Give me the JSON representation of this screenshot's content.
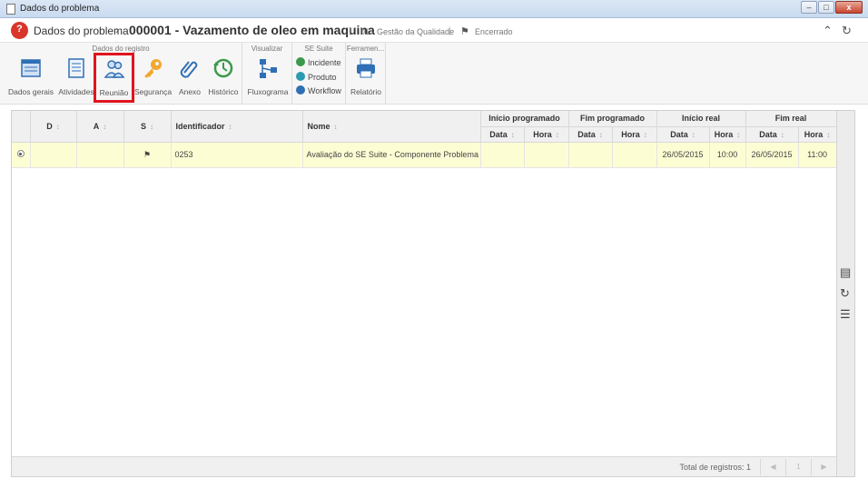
{
  "window": {
    "title": "Dados do problema",
    "minimize": "–",
    "maximize": "□",
    "close": "x"
  },
  "header": {
    "breadcrumb": "Dados do problema",
    "record_title": "000001 - Vazamento de oleo em maquina",
    "process": "01 - Gestão da Qualidade",
    "status": "Encerrado",
    "separator": "|",
    "chevron": "›",
    "status_icon": "⚑",
    "collapse_icon": "⌃",
    "refresh_icon": "↻"
  },
  "toolbar": {
    "groups": [
      {
        "label": "Dados do registro"
      },
      {
        "label": "Visualizar"
      },
      {
        "label": "SE Suite"
      },
      {
        "label": "Ferramen..."
      }
    ],
    "buttons": {
      "dados_gerais": "Dados gerais",
      "atividades": "Atividades",
      "reuniao": "Reunião",
      "seguranca": "Segurança",
      "anexo": "Anexo",
      "historico": "Histórico",
      "fluxograma": "Fluxograma",
      "incidente": "Incidente",
      "produto": "Produto",
      "workflow": "Workflow",
      "relatorio": "Relatório"
    },
    "selected": "reuniao"
  },
  "grid": {
    "columns": {
      "d": "D",
      "a": "A",
      "s": "S",
      "identificador": "Identificador",
      "nome": "Nome"
    },
    "group_headers": {
      "inicio_programado": "Início programado",
      "fim_programado": "Fim programado",
      "inicio_real": "Início real",
      "fim_real": "Fim real"
    },
    "sub": {
      "data": "Data",
      "hora": "Hora"
    },
    "sort_icon": "↕",
    "rows": [
      {
        "identificador": "0253",
        "nome": "Avaliação do SE Suite - Componente Problema",
        "inicio_prog_data": "",
        "inicio_prog_hora": "",
        "fim_prog_data": "",
        "fim_prog_hora": "",
        "inicio_real_data": "26/05/2015",
        "inicio_real_hora": "10:00",
        "fim_real_data": "26/05/2015",
        "fim_real_hora": "11:00",
        "status_icon": "⚑"
      }
    ],
    "footer": {
      "total": "Total de registros: 1",
      "page": "1",
      "prev": "◀",
      "next": "▶"
    }
  },
  "side_icons": {
    "view": "▤",
    "refresh": "↻",
    "list": "☰"
  },
  "colors": {
    "selected_row": "#fdfdd4",
    "selected_button": "#e0141e",
    "logo": "#d9362b"
  }
}
